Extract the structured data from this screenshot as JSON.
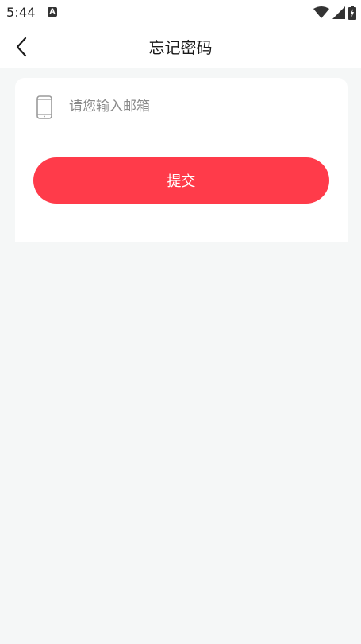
{
  "status_bar": {
    "time": "5:44",
    "notification_icon": "a-notification-icon",
    "right_icons": [
      "wifi-icon",
      "cellular-signal-icon",
      "battery-charging-icon"
    ]
  },
  "header": {
    "title": "忘记密码",
    "back_icon": "chevron-left-icon"
  },
  "form": {
    "email_icon": "phone-icon",
    "email_placeholder": "请您输入邮箱",
    "email_value": "",
    "submit_label": "提交"
  },
  "colors": {
    "accent": "#ff3b4a",
    "background": "#f5f7f7",
    "card": "#ffffff"
  }
}
